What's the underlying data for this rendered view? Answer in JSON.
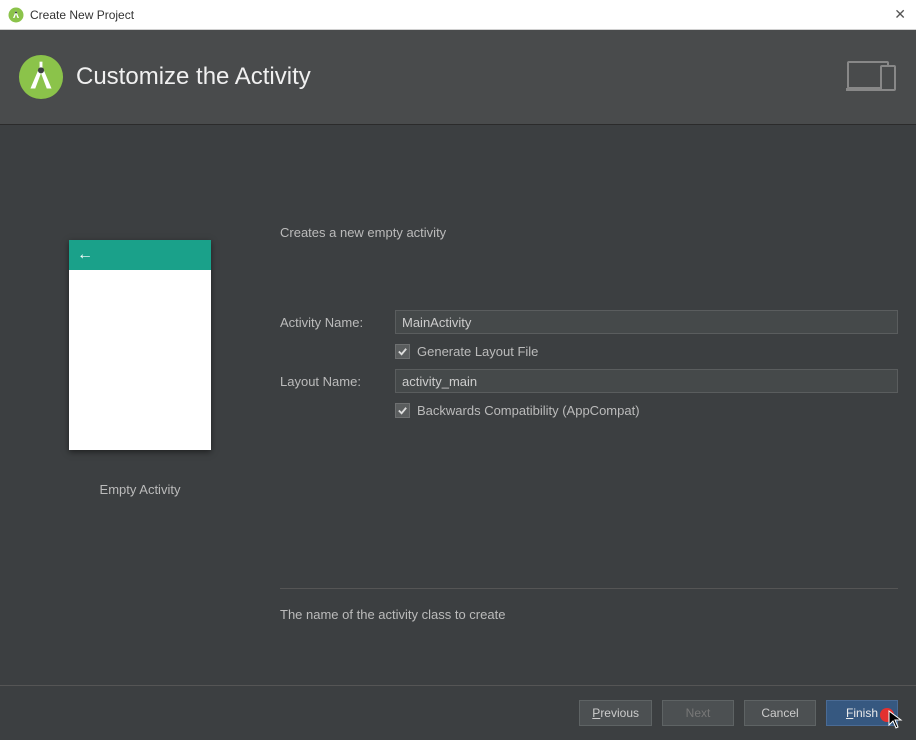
{
  "window": {
    "title": "Create New Project"
  },
  "header": {
    "title": "Customize the Activity"
  },
  "preview": {
    "label": "Empty Activity"
  },
  "form": {
    "description": "Creates a new empty activity",
    "activity_name_label": "Activity Name:",
    "activity_name_value": "MainActivity",
    "generate_layout_label": "Generate Layout File",
    "generate_layout_checked": true,
    "layout_name_label": "Layout Name:",
    "layout_name_value": "activity_main",
    "backwards_compat_label": "Backwards Compatibility (AppCompat)",
    "backwards_compat_checked": true,
    "hint": "The name of the activity class to create"
  },
  "buttons": {
    "previous": "Previous",
    "next": "Next",
    "cancel": "Cancel",
    "finish": "Finish"
  }
}
